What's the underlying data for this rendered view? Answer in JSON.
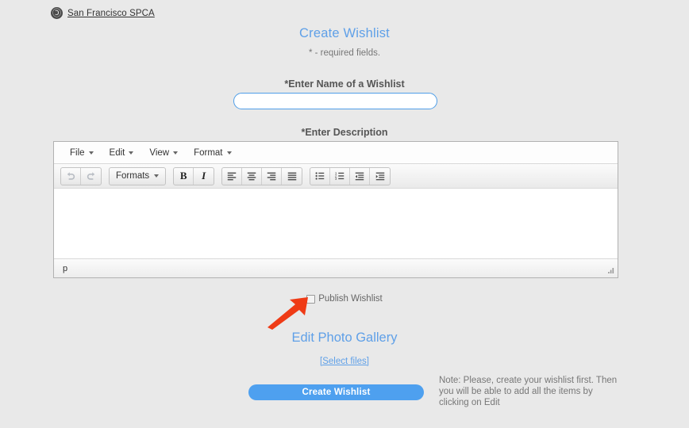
{
  "brand": {
    "logo_icon": "spca-circle-logo-icon",
    "name": "San Francisco SPCA"
  },
  "page": {
    "title": "Create Wishlist",
    "required_note": "* - required fields."
  },
  "form": {
    "name_label": "*Enter Name of a Wishlist",
    "name_value": "",
    "name_placeholder": "",
    "description_label": "*Enter Description"
  },
  "editor": {
    "menubar": [
      {
        "label": "File",
        "caret": "chevron-down-icon"
      },
      {
        "label": "Edit",
        "caret": "chevron-down-icon"
      },
      {
        "label": "View",
        "caret": "chevron-down-icon"
      },
      {
        "label": "Format",
        "caret": "chevron-down-icon"
      }
    ],
    "toolbar": {
      "undo": "undo-icon",
      "redo": "redo-icon",
      "formats_label": "Formats",
      "bold_label": "B",
      "italic_label": "I",
      "align_left": "align-left-icon",
      "align_center": "align-center-icon",
      "align_right": "align-right-icon",
      "align_justify": "align-justify-icon",
      "bullet_list": "bullet-list-icon",
      "numbered_list": "numbered-list-icon",
      "outdent": "outdent-icon",
      "indent": "indent-icon"
    },
    "content": "",
    "status_path": "p",
    "resize_handle": "resize-grip-icon"
  },
  "publish": {
    "label": "Publish Wishlist",
    "checked": false
  },
  "annotation": {
    "arrow_color": "#ef3b16",
    "points_to": "publish-wishlist-checkbox"
  },
  "gallery": {
    "title": "Edit Photo Gallery",
    "select_files_label": "[Select files]"
  },
  "submit": {
    "label": "Create Wishlist"
  },
  "note": {
    "text": "Note: Please, create your wishlist first. Then you will be able to add all the items by clicking on Edit"
  },
  "colors": {
    "background": "#e9e9e9",
    "accent_blue": "#5fa0e8",
    "button_blue": "#4ea0ef",
    "input_border": "#4f9ee8",
    "annotation_red": "#ef3b16"
  }
}
